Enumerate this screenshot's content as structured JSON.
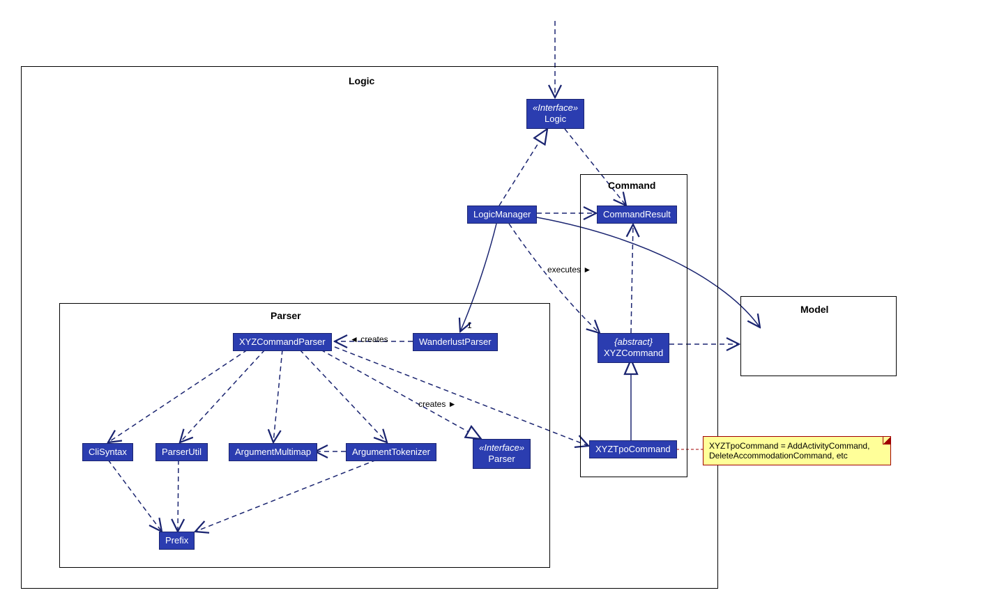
{
  "packages": {
    "logic": {
      "label": "Logic"
    },
    "command": {
      "label": "Command"
    },
    "parser": {
      "label": "Parser"
    },
    "model": {
      "label": "Model"
    }
  },
  "nodes": {
    "logicIf": {
      "stereotype": "«Interface»",
      "name": "Logic"
    },
    "logicMgr": {
      "name": "LogicManager"
    },
    "cmdResult": {
      "name": "CommandResult"
    },
    "xyzCmd": {
      "stereotype": "{abstract}",
      "name": "XYZCommand"
    },
    "xyzTpo": {
      "name": "XYZTpoCommand"
    },
    "wanderlust": {
      "name": "WanderlustParser"
    },
    "xyzParser": {
      "name": "XYZCommandParser"
    },
    "parserIf": {
      "stereotype": "«Interface»",
      "name": "Parser"
    },
    "argTok": {
      "name": "ArgumentTokenizer"
    },
    "argMulti": {
      "name": "ArgumentMultimap"
    },
    "parserUtil": {
      "name": "ParserUtil"
    },
    "cliSyntax": {
      "name": "CliSyntax"
    },
    "prefix": {
      "name": "Prefix"
    }
  },
  "labels": {
    "creates1": "◄ creates",
    "creates2": "creates ►",
    "executes": "executes ►",
    "one": "1"
  },
  "note": {
    "text": "XYZTpoCommand = AddActivityCommand, DeleteAccommodationCommand, etc"
  }
}
